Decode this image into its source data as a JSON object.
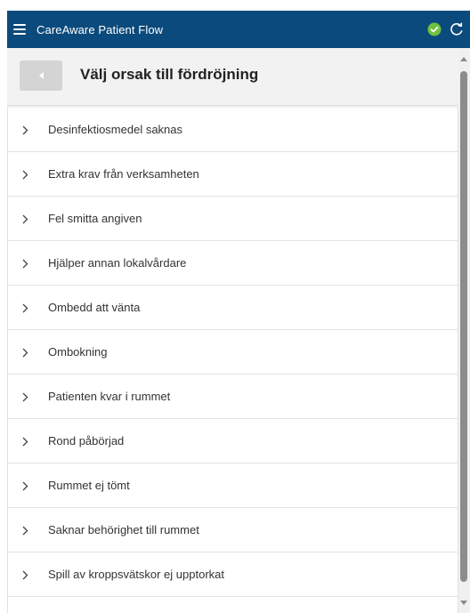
{
  "app": {
    "title": "CareAware Patient Flow"
  },
  "header": {
    "title": "Välj orsak till fördröjning"
  },
  "reasons": [
    {
      "label": "Desinfektiosmedel saknas"
    },
    {
      "label": "Extra krav från verksamheten"
    },
    {
      "label": "Fel smitta angiven"
    },
    {
      "label": "Hjälper annan lokalvårdare"
    },
    {
      "label": "Ombedd att vänta"
    },
    {
      "label": "Ombokning"
    },
    {
      "label": "Patienten kvar i rummet"
    },
    {
      "label": "Rond påbörjad"
    },
    {
      "label": "Rummet ej tömt"
    },
    {
      "label": "Saknar behörighet till rummet"
    },
    {
      "label": "Spill av kroppsvätskor ej upptorkat"
    },
    {
      "label": ""
    }
  ],
  "icons": {
    "menu": "hamburger-icon",
    "status": "check-circle-icon",
    "refresh": "refresh-icon",
    "back": "back-arrow-icon",
    "expand": "chevron-right-icon"
  },
  "colors": {
    "titlebar": "#0b4a7c",
    "status_ok": "#6fc23f",
    "back_button": "#d4d4d4"
  }
}
